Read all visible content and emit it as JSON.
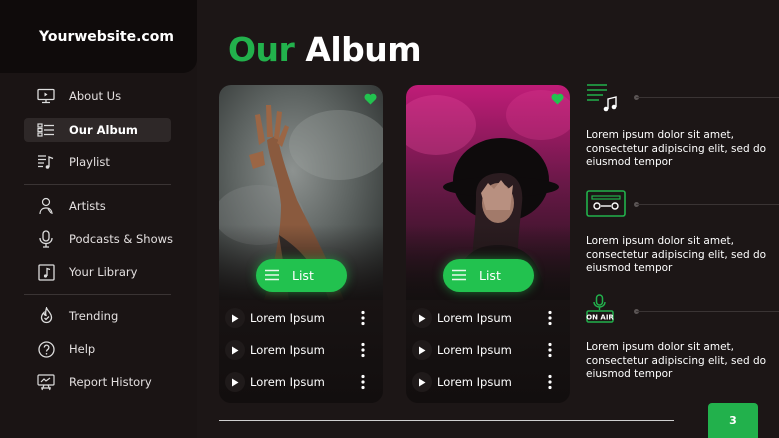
{
  "site": {
    "logo_text": "Yourwebsite.com"
  },
  "sidebar": {
    "items": [
      {
        "label": "About Us",
        "icon": "monitor-icon",
        "active": false
      },
      {
        "label": "Our Album",
        "icon": "album-list-icon",
        "active": true
      },
      {
        "label": "Playlist",
        "icon": "playlist-icon",
        "active": false
      },
      {
        "label": "Artists",
        "icon": "artist-icon",
        "active": false
      },
      {
        "label": "Podcasts & Shows",
        "icon": "microphone-icon",
        "active": false
      },
      {
        "label": "Your Library",
        "icon": "library-icon",
        "active": false
      },
      {
        "label": "Trending",
        "icon": "trending-icon",
        "active": false
      },
      {
        "label": "Help",
        "icon": "help-icon",
        "active": false
      },
      {
        "label": "Report History",
        "icon": "report-icon",
        "active": false
      }
    ]
  },
  "page": {
    "title_accent": "Our",
    "title_rest": "Album"
  },
  "albums": [
    {
      "photo": "hand-raised-smoke-photo",
      "button_label": "List",
      "tracks": [
        "Lorem Ipsum",
        "Lorem Ipsum",
        "Lorem Ipsum"
      ]
    },
    {
      "photo": "woman-hat-pink-smoke-photo",
      "button_label": "List",
      "tracks": [
        "Lorem Ipsum",
        "Lorem Ipsum",
        "Lorem Ipsum"
      ]
    }
  ],
  "features": [
    {
      "icon": "music-playlist-icon",
      "text": "Lorem ipsum dolor sit amet, consectetur adipiscing elit, sed do eiusmod tempor"
    },
    {
      "icon": "cassette-icon",
      "text": "Lorem ipsum dolor sit amet, consectetur adipiscing elit, sed do eiusmod tempor"
    },
    {
      "icon": "on-air-icon",
      "icon_text": "ON AIR",
      "text": "Lorem ipsum dolor sit amet, consectetur adipiscing elit, sed do eiusmod tempor"
    }
  ],
  "footer": {
    "page_number": "3"
  },
  "colors": {
    "accent": "#22b14c",
    "background": "#1c1616",
    "sidebar": "#1a1414"
  }
}
